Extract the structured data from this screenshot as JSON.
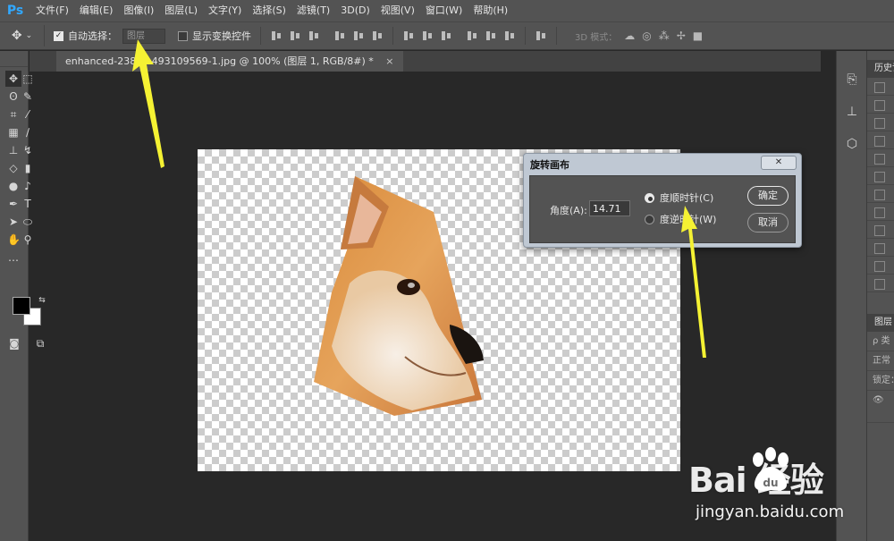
{
  "app": {
    "logo": "Ps"
  },
  "menu": [
    "文件(F)",
    "编辑(E)",
    "图像(I)",
    "图层(L)",
    "文字(Y)",
    "选择(S)",
    "滤镜(T)",
    "3D(D)",
    "视图(V)",
    "窗口(W)",
    "帮助(H)"
  ],
  "options_bar": {
    "auto_select_label": "自动选择：",
    "auto_select_checked": true,
    "auto_select_value": "图层",
    "show_transform_label": "显示变换控件",
    "show_transform_checked": false,
    "mode_3d_label": "3D 模式："
  },
  "document": {
    "tab_title": "enhanced-23831 493109569-1.jpg @ 100% (图层 1, RGB/8#) *",
    "tab_close": "×"
  },
  "right_panels": {
    "history_title": "历史记录",
    "layers_title": "图层",
    "layers_rows": [
      "ρ 类",
      "正常",
      "锁定："
    ]
  },
  "dialog": {
    "title": "旋转画布",
    "close": "✕",
    "angle_label": "角度(A):",
    "angle_value": "14.71",
    "cw_label": "度顺时针(C)",
    "ccw_label": "度逆时针(W)",
    "cw_selected": true,
    "ok_label": "确定",
    "cancel_label": "取消"
  },
  "watermark": {
    "brand": "Bai  经验",
    "url": "jingyan.baidu.com"
  },
  "colors": {
    "arrow": "#f5f233",
    "foreground": "#000000",
    "background": "#ffffff"
  }
}
